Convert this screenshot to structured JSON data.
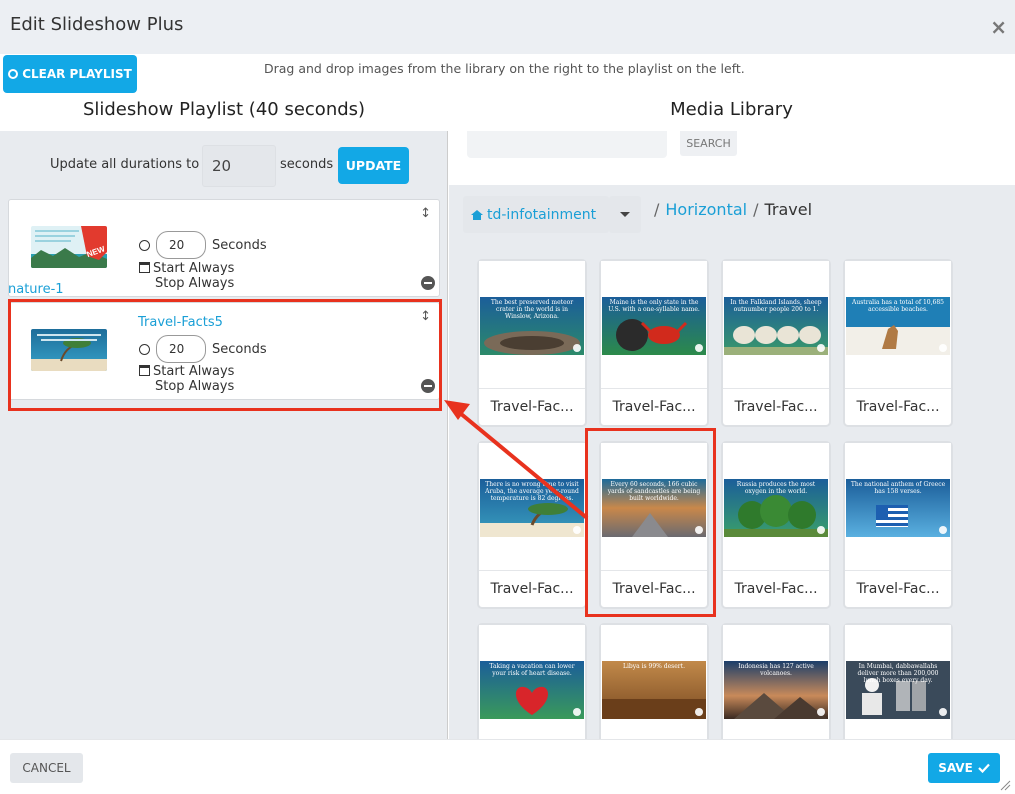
{
  "dialog": {
    "title": "Edit Slideshow Plus",
    "close_label": "×",
    "clear_playlist_label": "CLEAR PLAYLIST",
    "instructions": "Drag and drop images from the library on the right to the playlist on the left.",
    "accent_color": "#12a8e6",
    "highlight_color": "#e8321e"
  },
  "playlist": {
    "heading": "Slideshow Playlist (40 seconds)",
    "update_all_label": "Update all durations to",
    "update_all_value": "20",
    "seconds_label": "seconds",
    "update_button": "UPDATE",
    "items": [
      {
        "name": "nature-1",
        "duration": "20",
        "duration_unit": "Seconds",
        "start": "Start Always",
        "stop": "Stop Always"
      },
      {
        "name": "Travel-Facts5",
        "duration": "20",
        "duration_unit": "Seconds",
        "start": "Start Always",
        "stop": "Stop Always"
      }
    ]
  },
  "library": {
    "heading": "Media Library",
    "search_button": "SEARCH",
    "folder": "td-infotainment",
    "breadcrumb": [
      "Horizontal",
      "Travel"
    ],
    "breadcrumb_sep": "/",
    "cards": [
      {
        "label": "Travel-Fac...",
        "caption": "The best preserved meteor crater in the world is in Winslow, Arizona."
      },
      {
        "label": "Travel-Fac...",
        "caption": "Maine is the only state in the U.S. with a one-syllable name."
      },
      {
        "label": "Travel-Fac...",
        "caption": "In the Falkland Islands, sheep outnumber people 200 to 1."
      },
      {
        "label": "Travel-Fac...",
        "caption": "Australia has a total of 10,685 accessible beaches."
      },
      {
        "label": "Travel-Fac...",
        "caption": "There is no wrong time to visit Aruba, the average year-round temperature is 82 degrees."
      },
      {
        "label": "Travel-Fac...",
        "caption": "Every 60 seconds, 166 cubic yards of sandcastles are being built worldwide."
      },
      {
        "label": "Travel-Fac...",
        "caption": "Russia produces the most oxygen in the world."
      },
      {
        "label": "Travel-Fac...",
        "caption": "The national anthem of Greece has 158 verses."
      },
      {
        "label": "",
        "caption": "Taking a vacation can lower your risk of heart disease."
      },
      {
        "label": "",
        "caption": "Libya is 99% desert."
      },
      {
        "label": "",
        "caption": "Indonesia has 127 active volcanoes."
      },
      {
        "label": "",
        "caption": "In Mumbai, dabbawallahs deliver more than 200,000 lunch boxes every day."
      }
    ]
  },
  "footer": {
    "cancel_label": "CANCEL",
    "save_label": "SAVE",
    "save_icon": "checkmark-icon"
  }
}
